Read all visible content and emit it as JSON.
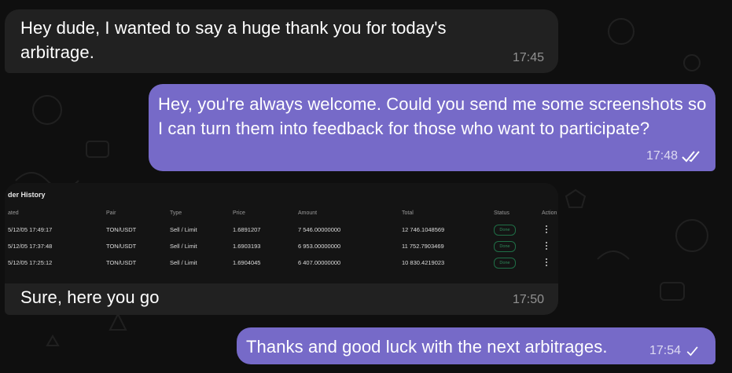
{
  "messages": [
    {
      "text": "Hey dude, I wanted to say a huge thank you for today's arbitrage.",
      "time": "17:45"
    },
    {
      "text": "Hey, you're always welcome. Could you send me some screenshots so I can turn them into feedback for those who want to participate?",
      "time": "17:48",
      "status": "read-double-check"
    },
    {
      "text": "Sure, here you go",
      "time": "17:50"
    },
    {
      "text": "Thanks and good luck with the next arbitrages.",
      "time": "17:54",
      "status": "sent-single-check"
    }
  ],
  "screenshot": {
    "title": "der History",
    "headers": [
      "ated",
      "Pair",
      "Type",
      "Price",
      "Amount",
      "Total",
      "Status",
      "Action"
    ],
    "rows": [
      {
        "date": "5/12/05 17:49:17",
        "pair": "TON/USDT",
        "type": "Sell / Limit",
        "price": "1.6891207",
        "amount": "7 546.00000000",
        "total": "12 746.1048569",
        "status": "Done"
      },
      {
        "date": "5/12/05 17:37:48",
        "pair": "TON/USDT",
        "type": "Sell / Limit",
        "price": "1.6903193",
        "amount": "6 953.00000000",
        "total": "11 752.7903469",
        "status": "Done"
      },
      {
        "date": "5/12/05 17:25:12",
        "pair": "TON/USDT",
        "type": "Sell / Limit",
        "price": "1.6904045",
        "amount": "6 407.00000000",
        "total": "10 830.4219023",
        "status": "Done"
      }
    ]
  },
  "colors": {
    "background": "#0f0f0f",
    "incoming": "#212121",
    "outgoing": "#766ac8",
    "status_done": "#2d8a5a"
  }
}
